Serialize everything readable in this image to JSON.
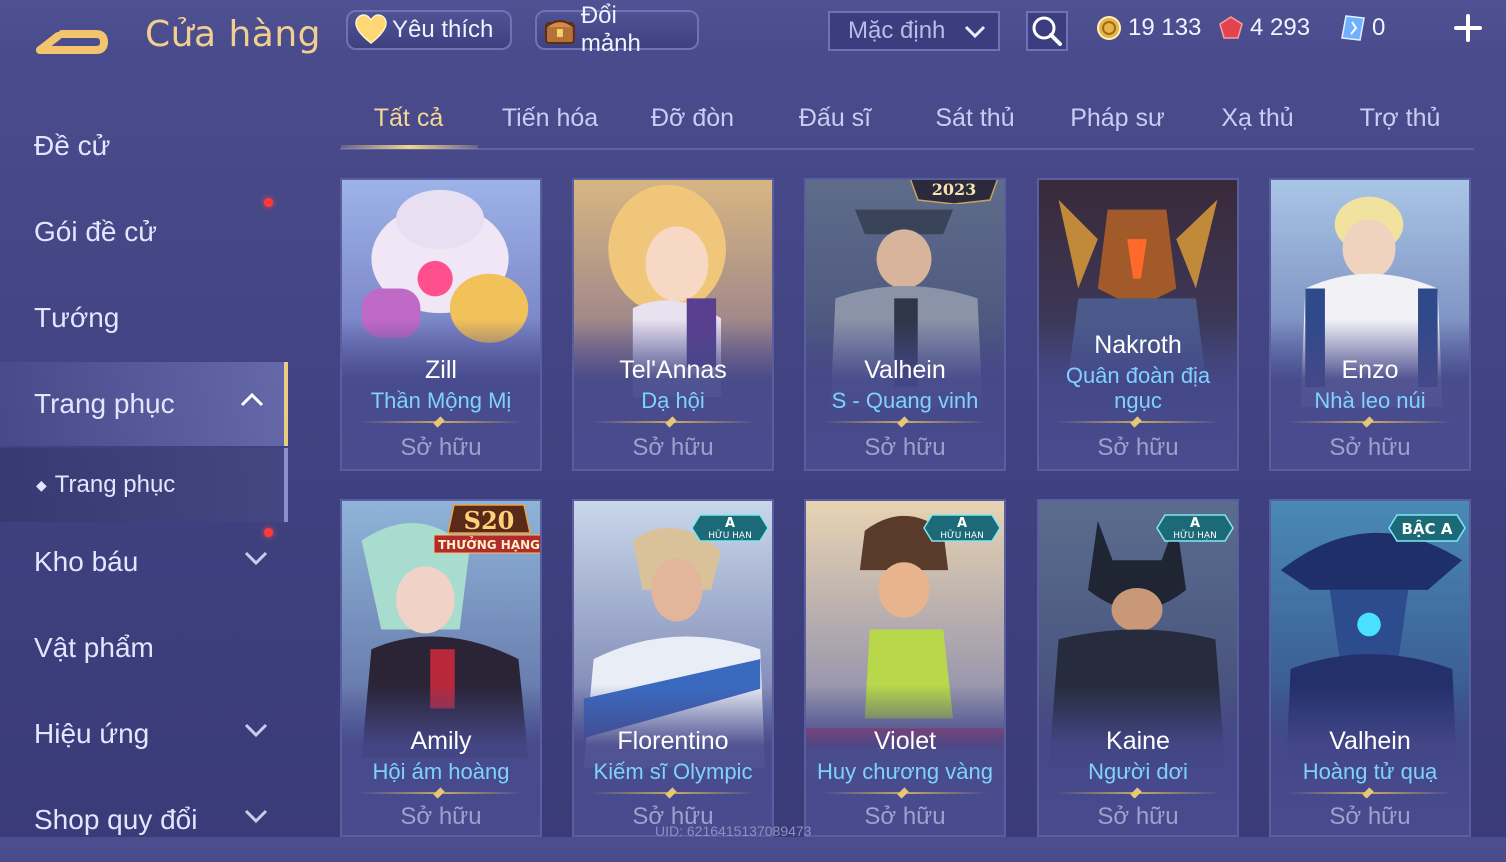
{
  "header": {
    "title": "Cửa hàng",
    "favorite_label": "Yêu thích",
    "exchange_label": "Đổi mảnh",
    "sort_value": "Mặc định",
    "currency_gold": "19 133",
    "currency_vouchers": "4 293",
    "currency_crystal": "0"
  },
  "sidebar": {
    "items": [
      {
        "label": "Đề cử"
      },
      {
        "label": "Gói đề cử"
      },
      {
        "label": "Tướng"
      },
      {
        "label": "Trang phục"
      },
      {
        "label": "Trang phục"
      },
      {
        "label": "Kho báu"
      },
      {
        "label": "Vật phẩm"
      },
      {
        "label": "Hiệu ứng"
      },
      {
        "label": "Shop quy đổi"
      }
    ]
  },
  "tabs": [
    "Tất cả",
    "Tiến hóa",
    "Đỡ đòn",
    "Đấu sĩ",
    "Sát thủ",
    "Pháp sư",
    "Xạ thủ",
    "Trợ thủ"
  ],
  "cards": [
    {
      "hero": "Zill",
      "skin": "Thần Mộng Mị",
      "status": "Sở hữu",
      "badge": ""
    },
    {
      "hero": "Tel'Annas",
      "skin": "Dạ hội",
      "status": "Sở hữu",
      "badge": ""
    },
    {
      "hero": "Valhein",
      "skin": "S - Quang vinh",
      "status": "Sở hữu",
      "badge": "2023"
    },
    {
      "hero": "Nakroth",
      "skin": "Quân đoàn địa ngục",
      "status": "Sở hữu",
      "badge": ""
    },
    {
      "hero": "Enzo",
      "skin": "Nhà leo núi",
      "status": "Sở hữu",
      "badge": ""
    },
    {
      "hero": "Amily",
      "skin": "Hội ám hoàng",
      "status": "Sở hữu",
      "badge": "S20",
      "badge_sub": "THƯỞNG HẠNG"
    },
    {
      "hero": "Florentino",
      "skin": "Kiếm sĩ Olympic",
      "status": "Sở hữu",
      "badge": "A",
      "badge_sub": "HỮU HẠN"
    },
    {
      "hero": "Violet",
      "skin": "Huy chương vàng",
      "status": "Sở hữu",
      "badge": "A",
      "badge_sub": "HỮU HẠN"
    },
    {
      "hero": "Kaine",
      "skin": "Người dơi",
      "status": "Sở hữu",
      "badge": "A",
      "badge_sub": "HỮU HẠN"
    },
    {
      "hero": "Valhein",
      "skin": "Hoàng tử quạ",
      "status": "Sở hữu",
      "badge": "BẬC A"
    }
  ],
  "footer": {
    "uid": "UID: 6216415137089473"
  },
  "colors": {
    "accent_gold": "#f2cf8e",
    "skin_blue": "#7fd2ff",
    "notify_red": "#ff3a3a"
  }
}
